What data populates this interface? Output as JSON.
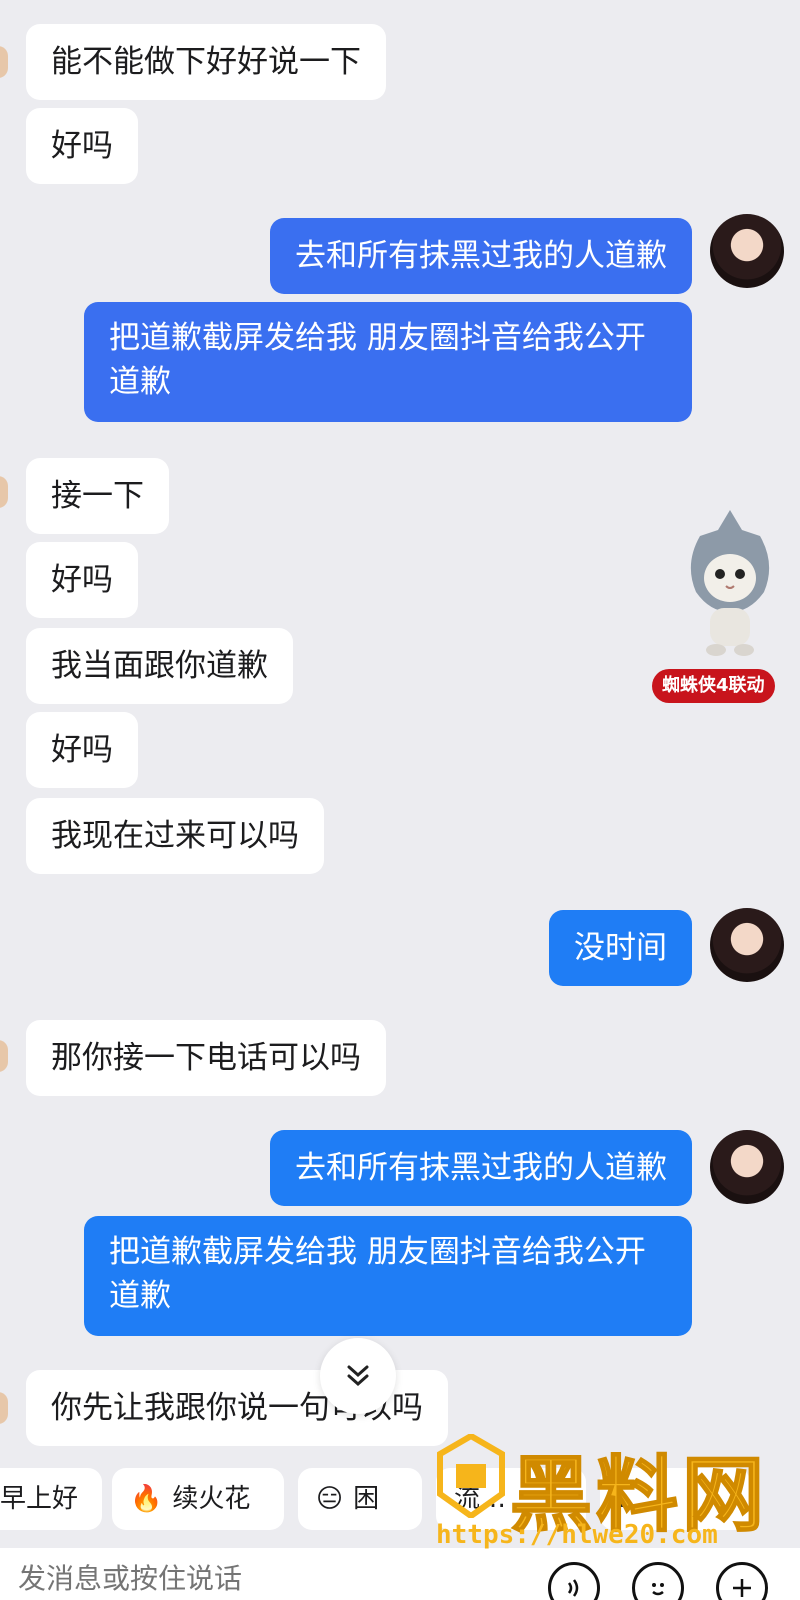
{
  "messages": [
    {
      "side": "in",
      "text": "能不能做下好好说一下"
    },
    {
      "side": "in",
      "text": "好吗"
    },
    {
      "side": "out",
      "text": "去和所有抹黑过我的人道歉"
    },
    {
      "side": "out",
      "text": "把道歉截屏发给我 朋友圈抖音给我公开道歉"
    },
    {
      "side": "in",
      "text": "接一下"
    },
    {
      "side": "in",
      "text": "好吗"
    },
    {
      "side": "in",
      "text": "我当面跟你道歉"
    },
    {
      "side": "in",
      "text": "好吗"
    },
    {
      "side": "in",
      "text": "我现在过来可以吗"
    },
    {
      "side": "out",
      "text": "没时间"
    },
    {
      "side": "in",
      "text": "那你接一下电话可以吗"
    },
    {
      "side": "out",
      "text": "去和所有抹黑过我的人道歉"
    },
    {
      "side": "out",
      "text": "把道歉截屏发给我 朋友圈抖音给我公开道歉"
    },
    {
      "side": "in",
      "text": "你先让我跟你说一句可以吗"
    }
  ],
  "sticker": {
    "badge": "蜘蛛侠4联动"
  },
  "quick_replies": [
    {
      "label": "早上好",
      "icon": ""
    },
    {
      "label": "续火花",
      "icon": "🔥"
    },
    {
      "label": "困",
      "icon": "😑"
    },
    {
      "label": "流…",
      "icon": ""
    },
    {
      "label": "…",
      "icon": ""
    }
  ],
  "input": {
    "placeholder": "发消息或按住说话"
  },
  "watermark": {
    "title": "黑料网",
    "url": "https://hlwe20.com"
  },
  "colors": {
    "outgoing": "#2f74ef",
    "incoming": "#ffffff",
    "background": "#ececf0"
  }
}
